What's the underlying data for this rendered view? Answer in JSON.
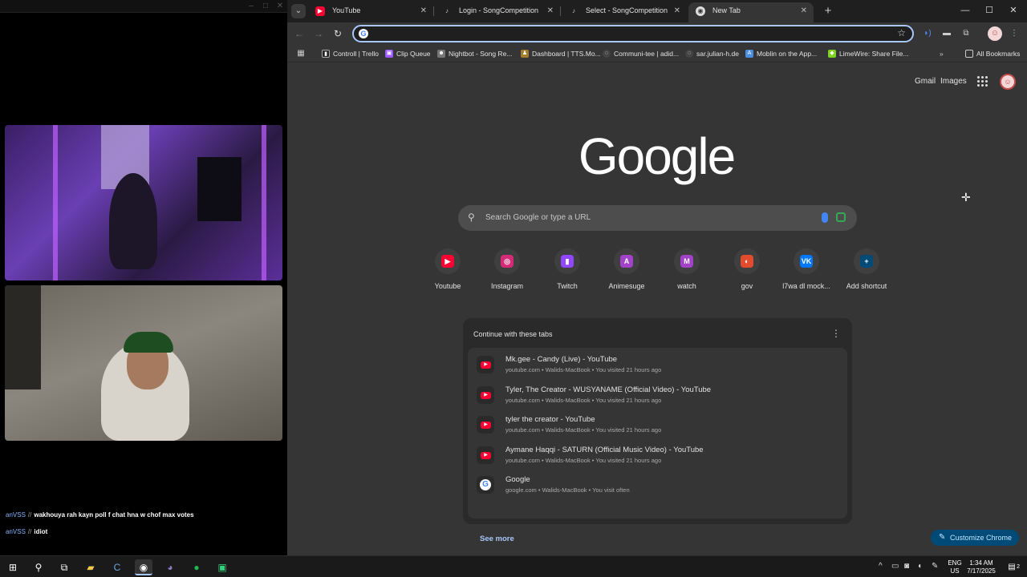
{
  "left_panel": {
    "chat": [
      {
        "user": "anVSS",
        "sep": "//",
        "text": "wakhouya rah kayn poll f chat hna w chof max votes"
      },
      {
        "user": "anVSS",
        "sep": "//",
        "text": "idiot"
      }
    ]
  },
  "tabs": [
    {
      "label": "YouTube",
      "icon": "youtube-icon"
    },
    {
      "label": "Login - SongCompetition",
      "icon": "songcompetition-icon"
    },
    {
      "label": "Select - SongCompetition",
      "icon": "songcompetition-icon"
    },
    {
      "label": "New Tab",
      "icon": "chrome-icon",
      "active": true
    }
  ],
  "toolbar": {
    "omnibox_value": ""
  },
  "bookmarks": [
    {
      "label": "Controll | Trello",
      "color": "#ffffff"
    },
    {
      "label": "Clip Queue",
      "color": "#9b59ff"
    },
    {
      "label": "Nightbot - Song Re...",
      "color": "#8a8a8a"
    },
    {
      "label": "Dashboard | TTS.Mo...",
      "color": "#d6a84a"
    },
    {
      "label": "Communi-tee | adid...",
      "color": "#cccccc"
    },
    {
      "label": "sar.julian-h.de",
      "color": "#cccccc"
    },
    {
      "label": "Moblin on the App...",
      "color": "#4a90e2"
    },
    {
      "label": "LimeWire: Share File...",
      "color": "#7ed321"
    }
  ],
  "bookmarks_more": "»",
  "all_bookmarks": "All Bookmarks",
  "ntp": {
    "gmail": "Gmail",
    "images": "Images",
    "logo": "Google",
    "search_placeholder": "Search Google or type a URL",
    "shortcuts": [
      {
        "label": "Youtube",
        "icon": "youtube-icon",
        "color": "#ff0033",
        "glyph": "▶"
      },
      {
        "label": "Instagram",
        "icon": "instagram-icon",
        "color": "#d62976",
        "glyph": "◎"
      },
      {
        "label": "Twitch",
        "icon": "twitch-icon",
        "color": "#9146ff",
        "glyph": "▮"
      },
      {
        "label": "Animesuge",
        "icon": "letter-a-icon",
        "color": "#a142c9",
        "glyph": "A"
      },
      {
        "label": "watch",
        "icon": "letter-m-icon",
        "color": "#a142c9",
        "glyph": "M"
      },
      {
        "label": "gov",
        "icon": "gov-icon",
        "color": "#e24b2b",
        "glyph": "◐"
      },
      {
        "label": "l7wa dl mock...",
        "icon": "vk-icon",
        "color": "#0077ff",
        "glyph": "VK"
      },
      {
        "label": "Add shortcut",
        "icon": "plus-icon",
        "color": "#004a77",
        "glyph": "+"
      }
    ],
    "continue_header": "Continue with these tabs",
    "continue_items": [
      {
        "title": "Mk.gee - Candy (Live) - YouTube",
        "meta": "youtube.com • Walids-MacBook • You visited 21 hours ago",
        "icon": "youtube-icon"
      },
      {
        "title": "Tyler, The Creator - WUSYANAME (Official Video) - YouTube",
        "meta": "youtube.com • Walids-MacBook • You visited 21 hours ago",
        "icon": "youtube-icon"
      },
      {
        "title": "tyler the creator - YouTube",
        "meta": "youtube.com • Walids-MacBook • You visited 21 hours ago",
        "icon": "youtube-icon"
      },
      {
        "title": "Aymane Haqqi - SATURN (Official Music Video) - YouTube",
        "meta": "youtube.com • Walids-MacBook • You visited 21 hours ago",
        "icon": "youtube-icon"
      },
      {
        "title": "Google",
        "meta": "google.com • Walids-MacBook • You visit often",
        "icon": "google-icon"
      }
    ],
    "see_more": "See more",
    "customize": "Customize Chrome"
  },
  "taskbar": {
    "lang": "ENG",
    "region": "US",
    "time": "1:34 AM",
    "date": "7/17/2025",
    "notif_count": "2"
  }
}
